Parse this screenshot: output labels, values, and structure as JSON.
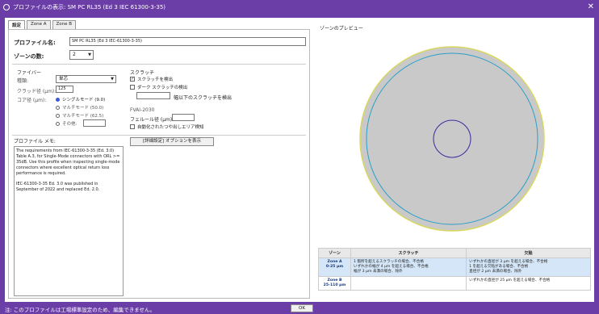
{
  "window": {
    "title": "プロファイルの表示: SM PC RL35 (Ed 3 IEC 61300-3-35)"
  },
  "tabs": [
    {
      "label": "設定"
    },
    {
      "label": "Zone A"
    },
    {
      "label": "Zone B"
    }
  ],
  "settings": {
    "profile_name_label": "プロファイル名:",
    "profile_name_value": "SM PC RL35 (Ed 3 IEC-61300-3-35)",
    "zones_label": "ゾーンの数:",
    "zones_value": "2",
    "fiber_section": "ファイバー",
    "fiber_type_label": "種類:",
    "fiber_type_value": "単芯",
    "cladding_label": "クラッド径 (µm):",
    "cladding_value": "125",
    "core_label": "コア径 (µm):",
    "core_options": [
      "シングルモード (9.0)",
      "マルチモード (50.0)",
      "マルチモード (62.5)",
      "その他:"
    ],
    "core_selected": 0,
    "scratch_section": "スクラッチ",
    "scratch_detect": "スクラッチを検出",
    "dark_scratch_detect": "ダーク スクラッチの検出",
    "ignore_width_label": "幅以下のスクラッチを検出",
    "fvai_section": "FVAI-2030",
    "ferrule_label": "フェルール径 (µm):",
    "auto_centered": "自動化されたつや出しエリア検知",
    "advanced_button": "[詳細設定] オプションを表示",
    "notes_label": "プロファイル メモ:",
    "notes_p1": "The requirements from IEC-61300-3-35 (Ed. 3.0) Table A.3, for Single-Mode connectors with ORL >= 35dB. Use this profile when inspecting single-mode connectors where excellent optical return loss performance is required.",
    "notes_p2": "IEC-61300-3-35 Ed. 3.0 was published in September of 2022 and replaced Ed. 2.0."
  },
  "preview": {
    "title": "ゾーンのプレビュー",
    "colors": {
      "outer": "#d8d860",
      "fill": "#c9c9c9",
      "zoneB": "#2aa0c8",
      "zoneA": "#3a2aa0"
    }
  },
  "zone_table": {
    "headers": [
      "ゾーン",
      "スクラッチ",
      "欠陥"
    ],
    "rows": [
      {
        "zone": "Zone A",
        "range": "0-25 µm",
        "scratch": [
          "1 箇所を超えるスクラッチの場合、不合格",
          "いずれかの幅が 4 µm を超える場合、不合格",
          "幅が 3 µm 未満の場合、除外"
        ],
        "defect": [
          "いずれかの直径が 3 µm を超える場合、不合格",
          "1 を超える欠陥がある場合、不合格",
          "直径が 2 µm 未満の場合、除外"
        ]
      },
      {
        "zone": "Zone B",
        "range": "25-110 µm",
        "scratch": [],
        "defect": [
          "いずれかの直径が 25 µm を超える場合、不合格"
        ]
      }
    ]
  },
  "footer": {
    "note": "注: このプロファイルは工場標準設定のため、編集できません。",
    "ok_label": "OK"
  }
}
